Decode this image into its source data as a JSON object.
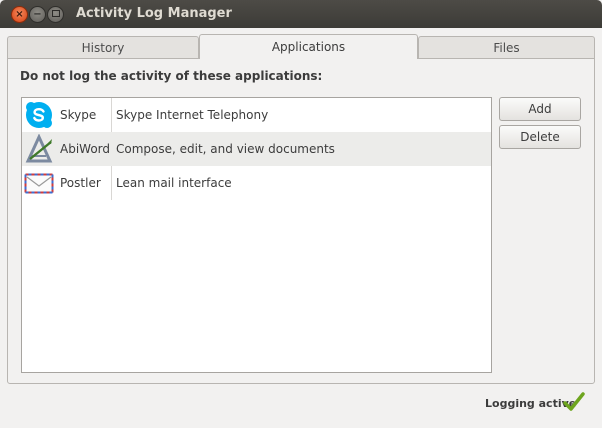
{
  "window": {
    "title": "Activity Log Manager",
    "close_glyph": "×",
    "min_glyph": "−"
  },
  "tabs": [
    {
      "label": "History",
      "active": false
    },
    {
      "label": "Applications",
      "active": true
    },
    {
      "label": "Files",
      "active": false
    }
  ],
  "panel": {
    "heading": "Do not log the activity of these applications:"
  },
  "applications": [
    {
      "name": "Skype",
      "description": "Skype Internet Telephony",
      "icon": "skype-icon",
      "selected": false
    },
    {
      "name": "AbiWord",
      "description": "Compose, edit, and view documents",
      "icon": "abiword-icon",
      "selected": true
    },
    {
      "name": "Postler",
      "description": "Lean mail interface",
      "icon": "postler-icon",
      "selected": false
    }
  ],
  "buttons": {
    "add": "Add",
    "delete": "Delete"
  },
  "status": {
    "text": "Logging active",
    "icon": "checkmark-icon",
    "color": "#6ea51f"
  },
  "colors": {
    "titlebar": "#3c3b37",
    "close_button": "#e35625",
    "selected_row": "#ececea"
  }
}
